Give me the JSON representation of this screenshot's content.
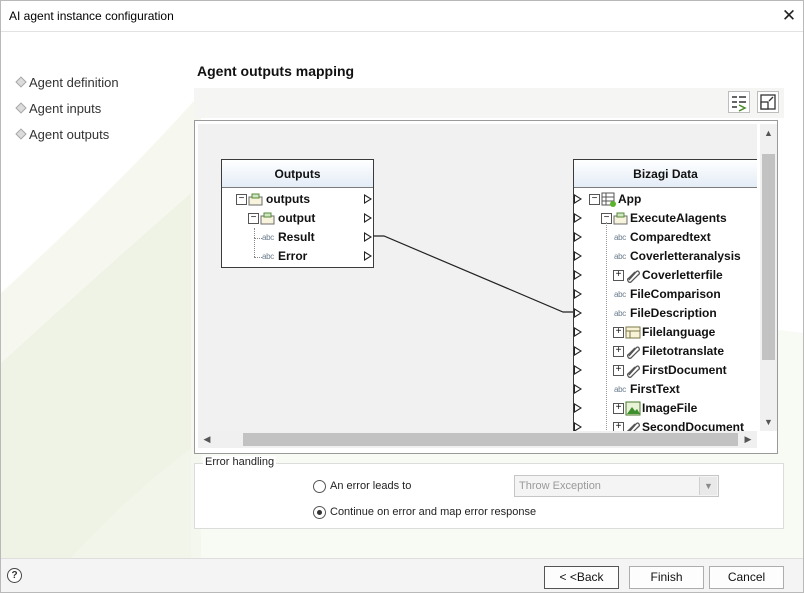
{
  "window": {
    "title": "AI agent instance configuration",
    "close_glyph": "✕"
  },
  "nav": {
    "items": [
      {
        "label": "Agent definition"
      },
      {
        "label": "Agent inputs"
      },
      {
        "label": "Agent outputs"
      }
    ]
  },
  "page": {
    "title": "Agent outputs mapping"
  },
  "toolbar": {
    "icons": [
      "auto-map-icon",
      "fit-view-icon"
    ]
  },
  "outputs_box": {
    "title": "Outputs",
    "rows": [
      {
        "label": "outputs",
        "expander": "−",
        "icon": "object-icon"
      },
      {
        "label": "output",
        "expander": "−",
        "icon": "object-icon"
      },
      {
        "label": "Result",
        "icon_text": "abc"
      },
      {
        "label": "Error",
        "icon_text": "abc"
      }
    ]
  },
  "data_box": {
    "title": "Bizagi Data",
    "rows": [
      {
        "label": "App",
        "expander": "−",
        "icon": "entity-icon"
      },
      {
        "label": "ExecuteAIagents",
        "expander": "−",
        "icon": "object-icon"
      },
      {
        "label": "Comparedtext",
        "icon_text": "abc"
      },
      {
        "label": "Coverletteranalysis",
        "icon_text": "abc"
      },
      {
        "label": "Coverletterfile",
        "expander": "+",
        "icon": "attachment-icon"
      },
      {
        "label": "FileComparison",
        "icon_text": "abc"
      },
      {
        "label": "FileDescription",
        "icon_text": "abc"
      },
      {
        "label": "Filelanguage",
        "expander": "+",
        "icon": "table-icon"
      },
      {
        "label": "Filetotranslate",
        "expander": "+",
        "icon": "attachment-icon"
      },
      {
        "label": "FirstDocument",
        "expander": "+",
        "icon": "attachment-icon"
      },
      {
        "label": "FirstText",
        "icon_text": "abc"
      },
      {
        "label": "ImageFile",
        "expander": "+",
        "icon": "image-icon"
      },
      {
        "label": "SecondDocument",
        "expander": "+",
        "icon": "attachment-icon"
      }
    ]
  },
  "mapping": {
    "from": "Result",
    "to": "FileDescription"
  },
  "scroll": {
    "up": "▲",
    "down": "▼",
    "left": "◀",
    "right": "▶"
  },
  "error_handling": {
    "legend": "Error handling",
    "options": [
      {
        "label": "An error leads to",
        "checked": false
      },
      {
        "label": "Continue on error and map error response",
        "checked": true
      }
    ],
    "select_value": "Throw Exception",
    "select_arrow": "▼"
  },
  "footer": {
    "help": "?",
    "back": "< <Back",
    "finish": "Finish",
    "cancel": "Cancel"
  },
  "colors": {
    "accent": "#e4ecf6",
    "border": "#3b3b3b"
  }
}
